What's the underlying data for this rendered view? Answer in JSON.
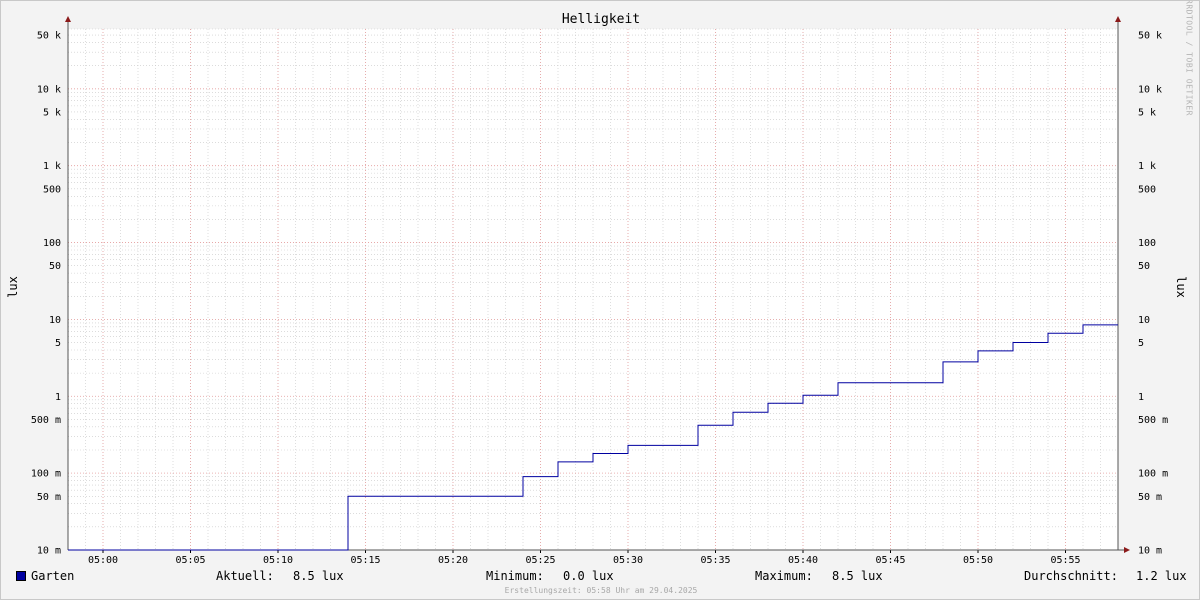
{
  "title": "Helligkeit",
  "watermark": "RRDTOOL / TOBI OETIKER",
  "footer": "Erstellungszeit: 05:58 Uhr am 29.04.2025",
  "legend": {
    "series_name": "Garten",
    "series_color": "#0000a0",
    "current_label": "Aktuell:",
    "current_value": "8.5 lux",
    "min_label": "Minimum:",
    "min_value": "0.0 lux",
    "max_label": "Maximum:",
    "max_value": "8.5 lux",
    "avg_label": "Durchschnitt:",
    "avg_value": "1.2 lux"
  },
  "colors": {
    "background": "#f3f3f3",
    "plot_background": "#ffffff",
    "major_grid": "#e8a0a0",
    "minor_grid": "#c8c8c8",
    "line": "#0000a0",
    "arrow": "#8b1a1a"
  },
  "chart_data": {
    "type": "line",
    "title": "Helligkeit",
    "ylabel": "lux",
    "ylabel_right": "lux",
    "yscale": "log",
    "ylim": [
      0.01,
      60000
    ],
    "xlim": [
      "04:58",
      "05:58"
    ],
    "grid": true,
    "legend": "bottom",
    "x_ticks": [
      "05:00",
      "05:05",
      "05:10",
      "05:15",
      "05:20",
      "05:25",
      "05:30",
      "05:35",
      "05:40",
      "05:45",
      "05:50",
      "05:55"
    ],
    "y_ticks": [
      {
        "value": 50000,
        "label": "50 k"
      },
      {
        "value": 10000,
        "label": "10 k"
      },
      {
        "value": 5000,
        "label": "5 k"
      },
      {
        "value": 1000,
        "label": "1 k"
      },
      {
        "value": 500,
        "label": "500"
      },
      {
        "value": 100,
        "label": "100"
      },
      {
        "value": 50,
        "label": "50"
      },
      {
        "value": 10,
        "label": "10"
      },
      {
        "value": 5,
        "label": "5"
      },
      {
        "value": 1,
        "label": "1"
      },
      {
        "value": 0.5,
        "label": "500 m"
      },
      {
        "value": 0.1,
        "label": "100 m"
      },
      {
        "value": 0.05,
        "label": "50 m"
      },
      {
        "value": 0.01,
        "label": "10 m"
      }
    ],
    "series": [
      {
        "name": "Garten",
        "color": "#0000a0",
        "step": true,
        "points": [
          {
            "x": "04:58",
            "y": 0.01
          },
          {
            "x": "05:14",
            "y": 0.05
          },
          {
            "x": "05:24",
            "y": 0.09
          },
          {
            "x": "05:26",
            "y": 0.14
          },
          {
            "x": "05:28",
            "y": 0.18
          },
          {
            "x": "05:30",
            "y": 0.23
          },
          {
            "x": "05:34",
            "y": 0.42
          },
          {
            "x": "05:36",
            "y": 0.62
          },
          {
            "x": "05:38",
            "y": 0.81
          },
          {
            "x": "05:40",
            "y": 1.03
          },
          {
            "x": "05:42",
            "y": 1.5
          },
          {
            "x": "05:48",
            "y": 2.8
          },
          {
            "x": "05:50",
            "y": 3.9
          },
          {
            "x": "05:52",
            "y": 5.0
          },
          {
            "x": "05:54",
            "y": 6.6
          },
          {
            "x": "05:56",
            "y": 8.5
          },
          {
            "x": "05:58",
            "y": 8.5
          }
        ]
      }
    ]
  }
}
